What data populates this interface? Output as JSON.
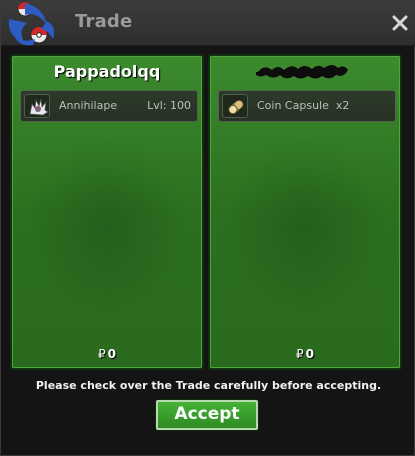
{
  "window": {
    "title": "Trade",
    "logo_icon": "pokeball-swirl-logo",
    "close_icon": "close-x-icon"
  },
  "left_panel": {
    "player_name": "Pappadolqq",
    "item": {
      "icon": "annihilape-sprite-icon",
      "name": "Annihilape",
      "level": "Lvl: 100"
    },
    "money_symbol": "₽",
    "money": "0"
  },
  "right_panel": {
    "player_name_redacted": true,
    "item": {
      "icon": "coin-capsule-icon",
      "name": "Coin Capsule  x2"
    },
    "money_symbol": "₽",
    "money": "0"
  },
  "notice": "Please check over the Trade carefully before accepting.",
  "accept_label": "Accept",
  "colors": {
    "panel_green": "#2f7524",
    "accept_green": "#3a9e2c",
    "titlebar": "#333333"
  }
}
